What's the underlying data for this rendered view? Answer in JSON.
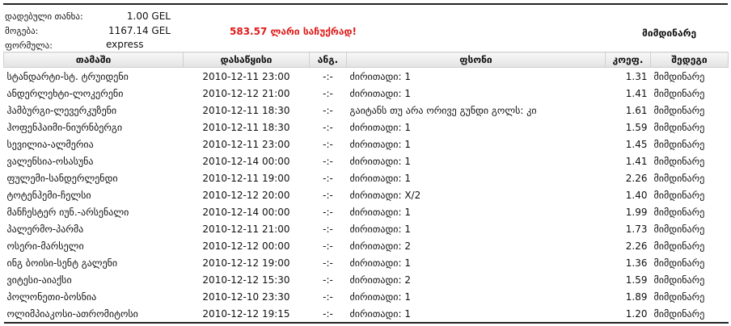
{
  "summary": {
    "stake_label": "დადებული თანხა:",
    "stake_value": "1.00 GEL",
    "win_label": "მოგება:",
    "win_value": "1167.14 GEL",
    "formula_label": "ფორმულა:",
    "formula_value": "express",
    "promo_text": "583.57 ლარი საჩუქრად!",
    "overall_status": "მიმდინარე"
  },
  "table": {
    "headers": {
      "match": "თამაში",
      "start": "დასაწყისი",
      "score": "ანგ.",
      "price": "ფსონი",
      "odds": "კოეფ.",
      "result": "შედეგი"
    },
    "rows": [
      {
        "match": "სტანდარტი-სტ. ტრუიდენი",
        "start": "2010-12-11 23:00",
        "score": "-:-",
        "price": "ძირითადი: 1",
        "odds": "1.31",
        "result": "მიმდინარე"
      },
      {
        "match": "ანდერლეხტი-ლოკერენი",
        "start": "2010-12-12 21:00",
        "score": "-:-",
        "price": "ძირითადი: 1",
        "odds": "1.41",
        "result": "მიმდინარე"
      },
      {
        "match": "ჰამბურგი-ლევერკუზენი",
        "start": "2010-12-11 18:30",
        "score": "-:-",
        "price": "გაიტანს თუ არა ორივე გუნდი გოლს: კი",
        "odds": "1.61",
        "result": "მიმდინარე"
      },
      {
        "match": "ჰოფენჰაიმი-ნიურნბერგი",
        "start": "2010-12-11 18:30",
        "score": "-:-",
        "price": "ძირითადი: 1",
        "odds": "1.59",
        "result": "მიმდინარე"
      },
      {
        "match": "სევილია-ალმერია",
        "start": "2010-12-11 23:00",
        "score": "-:-",
        "price": "ძირითადი: 1",
        "odds": "1.45",
        "result": "მიმდინარე"
      },
      {
        "match": "ვალენსია-ოსასუნა",
        "start": "2010-12-14 00:00",
        "score": "-:-",
        "price": "ძირითადი: 1",
        "odds": "1.41",
        "result": "მიმდინარე"
      },
      {
        "match": "ფულემი-სანდერლენდი",
        "start": "2010-12-11 19:00",
        "score": "-:-",
        "price": "ძირითადი: 1",
        "odds": "2.26",
        "result": "მიმდინარე"
      },
      {
        "match": "ტოტენჰემი-ჩელსი",
        "start": "2010-12-12 20:00",
        "score": "-:-",
        "price": "ძირითადი: X/2",
        "odds": "1.40",
        "result": "მიმდინარე"
      },
      {
        "match": "მანჩესტერ იუნ.-არსენალი",
        "start": "2010-12-14 00:00",
        "score": "-:-",
        "price": "ძირითადი: 1",
        "odds": "1.99",
        "result": "მიმდინარე"
      },
      {
        "match": "პალერმო-პარმა",
        "start": "2010-12-11 21:00",
        "score": "-:-",
        "price": "ძირითადი: 1",
        "odds": "1.73",
        "result": "მიმდინარე"
      },
      {
        "match": "ოსერი-მარსელი",
        "start": "2010-12-12 00:00",
        "score": "-:-",
        "price": "ძირითადი: 2",
        "odds": "2.26",
        "result": "მიმდინარე"
      },
      {
        "match": "ინგ ბოისი-სენტ გალენი",
        "start": "2010-12-12 19:00",
        "score": "-:-",
        "price": "ძირითადი: 1",
        "odds": "1.36",
        "result": "მიმდინარე"
      },
      {
        "match": "ვიტესი-აიაქსი",
        "start": "2010-12-12 15:30",
        "score": "-:-",
        "price": "ძირითადი: 2",
        "odds": "1.59",
        "result": "მიმდინარე"
      },
      {
        "match": "პოლონეთი-ბოსნია",
        "start": "2010-12-10 23:30",
        "score": "-:-",
        "price": "ძირითადი: 1",
        "odds": "1.89",
        "result": "მიმდინარე"
      },
      {
        "match": "ოლიმპიაკოსი-ათრომიტოსი",
        "start": "2010-12-12 19:15",
        "score": "-:-",
        "price": "ძირითადი: 1",
        "odds": "1.20",
        "result": "მიმდინარე"
      }
    ]
  }
}
